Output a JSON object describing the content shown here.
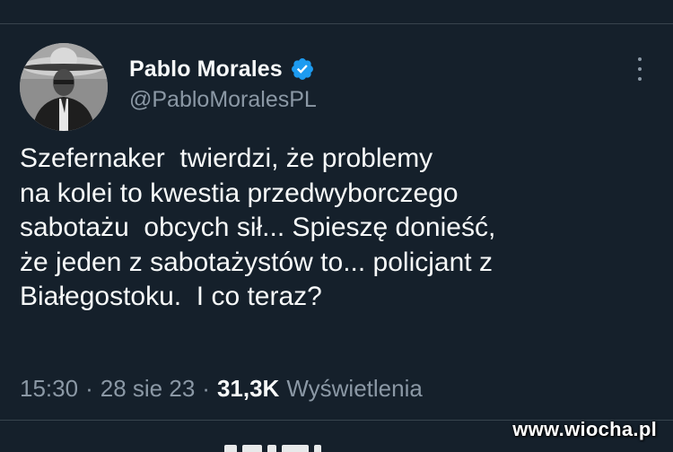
{
  "author": {
    "display_name": "Pablo Morales",
    "handle": "@PabloMoralesPL",
    "avatar_icon": "portrait-with-sombrero",
    "verified_icon": "verified-badge-icon",
    "verified_color": "#1d9bf0"
  },
  "tweet": {
    "lines": [
      "Szefernaker  twierdzi, że problemy",
      "na kolei to kwestia przedwyborczego",
      "sabotażu  obcych sił... Spieszę donieść,",
      "że jeden z sabotażystów to... policjant z",
      "Białegostoku.  I co teraz?"
    ]
  },
  "meta": {
    "time": "15:30",
    "separator": "·",
    "date": "28 sie 23",
    "views_count": "31,3K",
    "views_label": "Wyświetlenia"
  },
  "watermark": "www.wiocha.pl",
  "colors": {
    "background": "#15202b",
    "text_primary": "#f7f9f9",
    "text_secondary": "#8b98a5",
    "divider": "#38444d"
  }
}
